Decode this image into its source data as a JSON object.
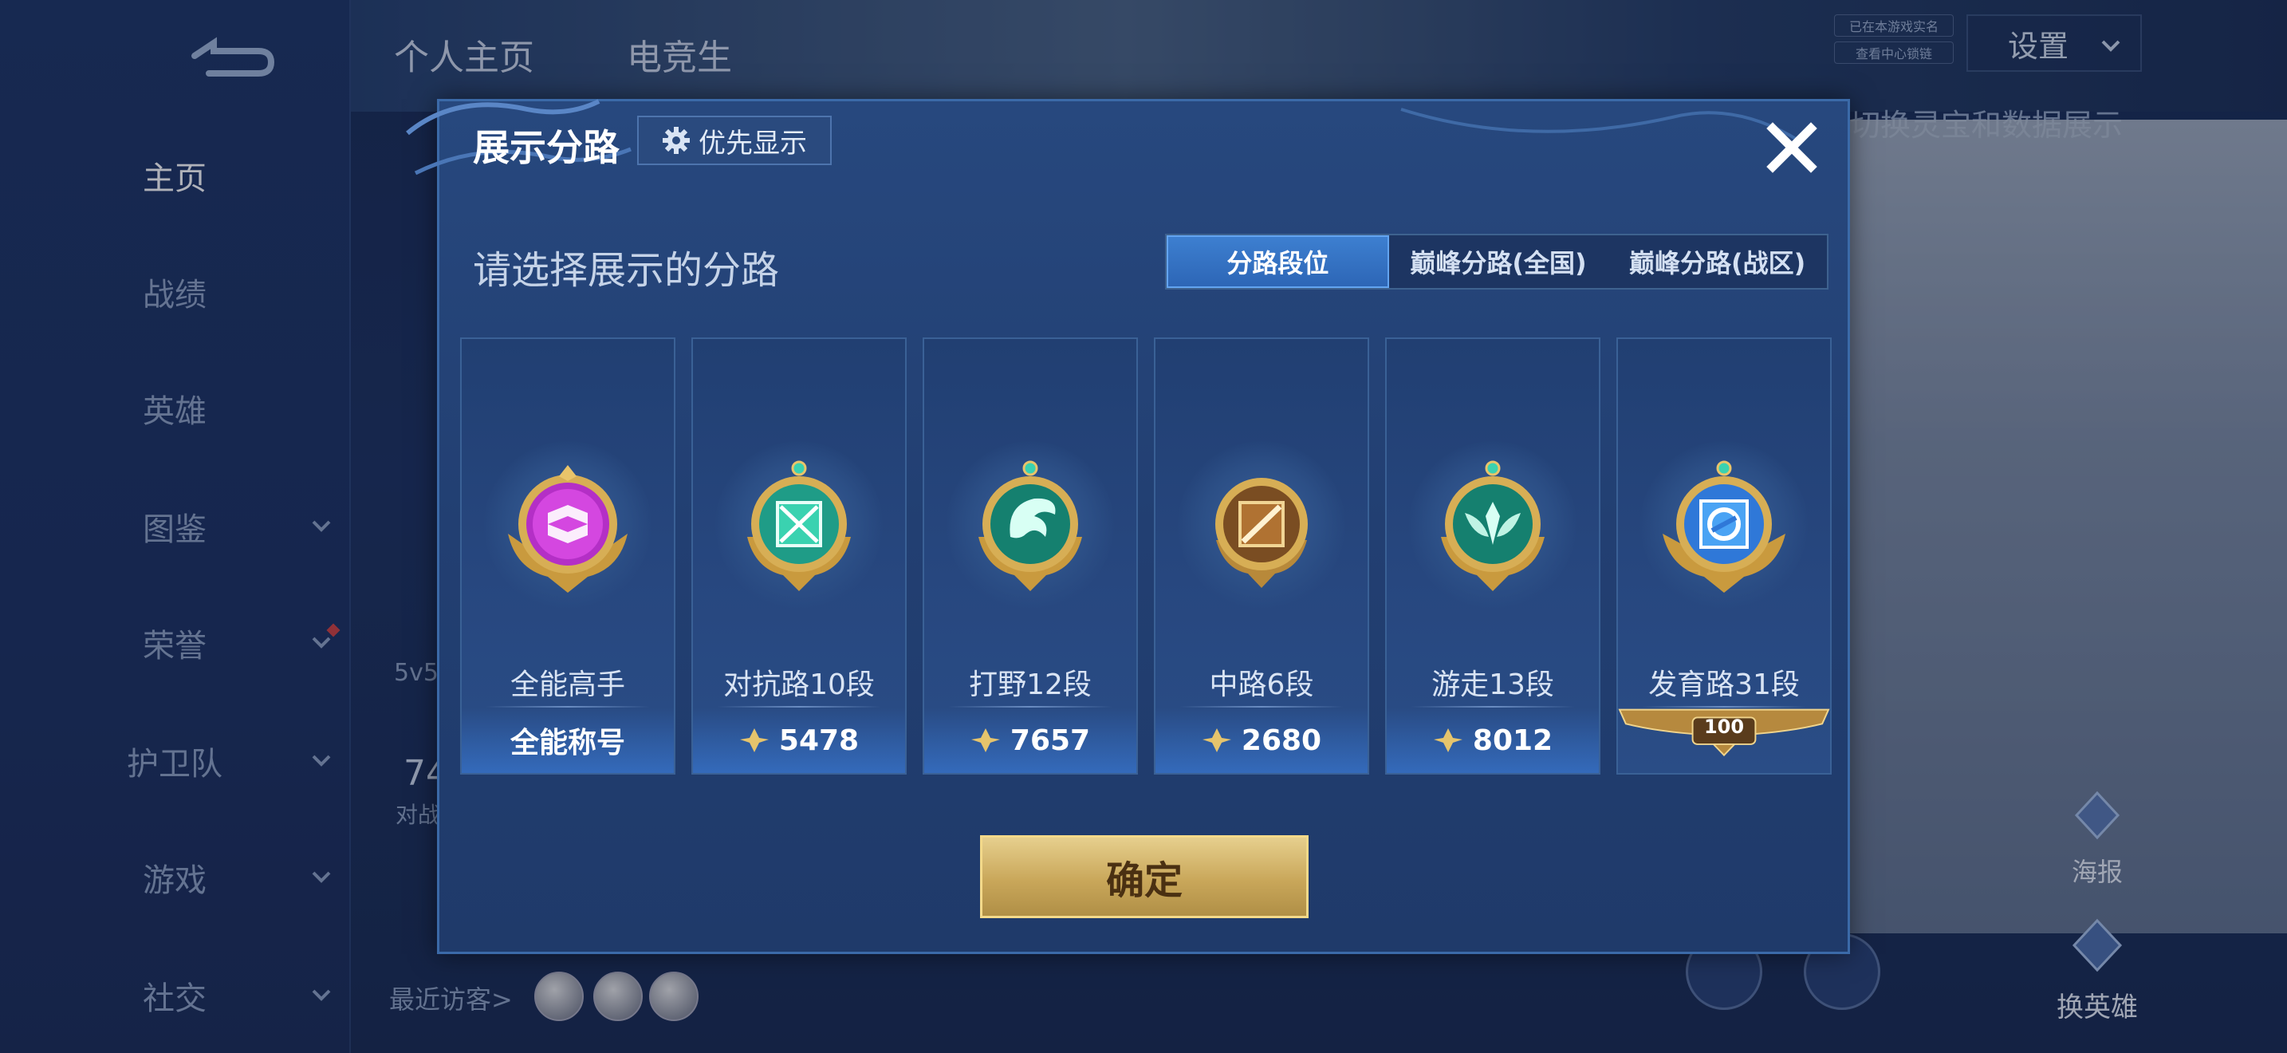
{
  "background": {
    "nav_items": [
      {
        "label": "主页",
        "active": true,
        "has_chevron": false
      },
      {
        "label": "战绩",
        "active": false,
        "has_chevron": false
      },
      {
        "label": "英雄",
        "active": false,
        "has_chevron": false
      },
      {
        "label": "图鉴",
        "active": false,
        "has_chevron": true
      },
      {
        "label": "荣誉",
        "active": false,
        "has_chevron": true
      },
      {
        "label": "护卫队",
        "active": false,
        "has_chevron": true
      },
      {
        "label": "游戏",
        "active": false,
        "has_chevron": true
      },
      {
        "label": "社交",
        "active": false,
        "has_chevron": true
      }
    ],
    "top_tabs": [
      "个人主页",
      "电竞生"
    ],
    "settings_label": "设置",
    "badges": [
      "已在本游戏实名",
      "查看中心锁链"
    ],
    "hint": "切换灵宝和数据展示",
    "mode_text": "5v5",
    "stat_text": "74",
    "stat_sub": "对战",
    "recent_visitors": "最近访客>",
    "poster_label": "海报",
    "swap_hero_label": "换英雄"
  },
  "modal": {
    "title": "展示分路",
    "priority_label": "优先显示",
    "subtitle": "请选择展示的分路",
    "tabs": [
      {
        "label": "分路段位",
        "active": true
      },
      {
        "label": "巅峰分路(全国)",
        "active": false
      },
      {
        "label": "巅峰分路(战区)",
        "active": false
      }
    ],
    "cards": [
      {
        "name": "全能高手",
        "footer": "全能称号",
        "icon": "all-round-emblem-icon",
        "color": "#c13ad0"
      },
      {
        "name": "对抗路10段",
        "footer": "5478",
        "icon": "clash-lane-emblem-icon",
        "color": "#2fc8a8"
      },
      {
        "name": "打野12段",
        "footer": "7657",
        "icon": "jungle-emblem-icon",
        "color": "#1fb59c"
      },
      {
        "name": "中路6段",
        "footer": "2680",
        "icon": "mid-lane-emblem-icon",
        "color": "#c08a3c"
      },
      {
        "name": "游走13段",
        "footer": "8012",
        "icon": "roam-emblem-icon",
        "color": "#21b596"
      },
      {
        "name": "发育路31段",
        "footer": "100",
        "icon": "farm-lane-emblem-icon",
        "color": "#3e8ae6"
      }
    ],
    "confirm_label": "确定"
  }
}
